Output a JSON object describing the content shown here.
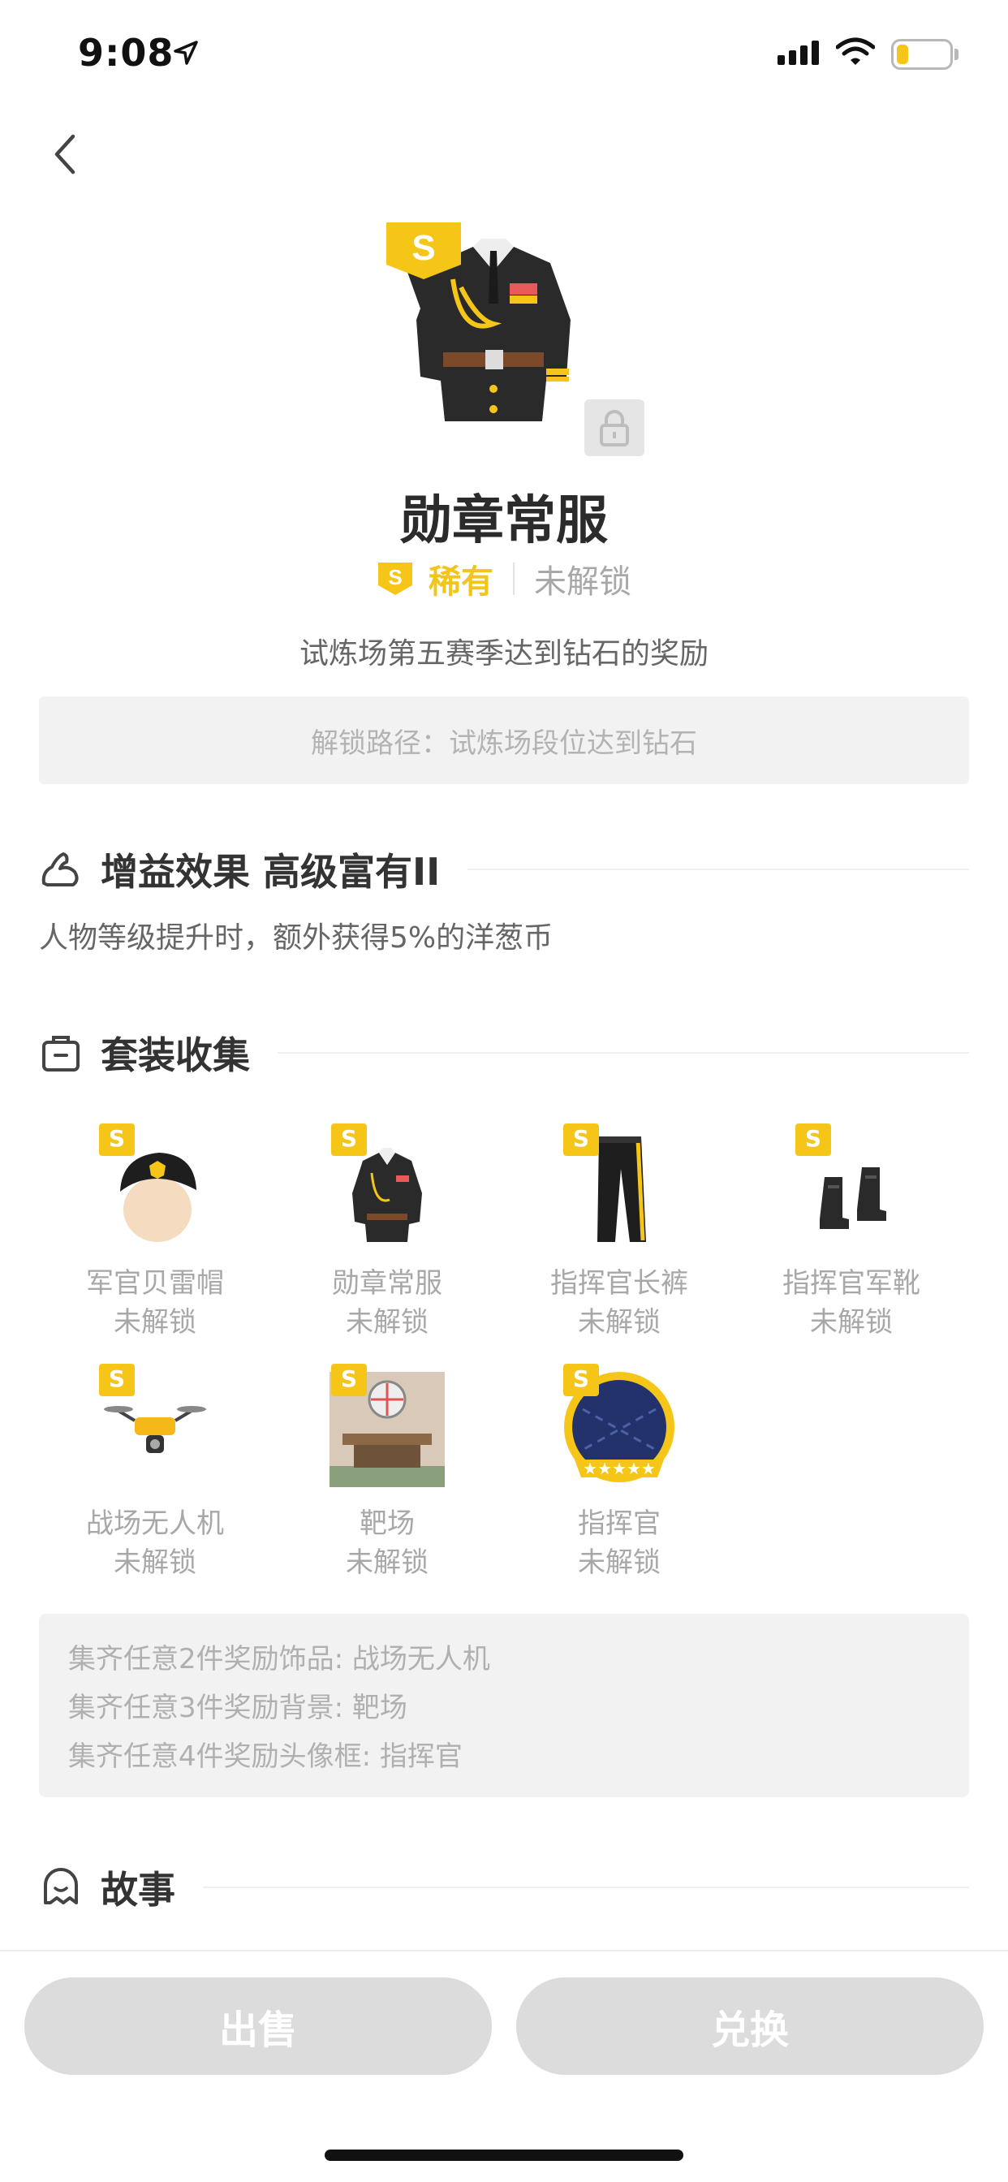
{
  "status_bar": {
    "time": "9:08"
  },
  "item": {
    "title": "勋章常服",
    "rarity_badge": "S",
    "rarity": "稀有",
    "lock_status": "未解锁",
    "description": "试炼场第五赛季达到钻石的奖励",
    "unlock_path": "解锁路径：试炼场段位达到钻石"
  },
  "buff": {
    "title": "增益效果 高级富有II",
    "description": "人物等级提升时，额外获得5%的洋葱币"
  },
  "suit": {
    "title": "套装收集",
    "items": [
      {
        "name": "军官贝雷帽",
        "status": "未解锁",
        "badge": "S",
        "icon": "beret-icon"
      },
      {
        "name": "勋章常服",
        "status": "未解锁",
        "badge": "S",
        "icon": "uniform-icon"
      },
      {
        "name": "指挥官长裤",
        "status": "未解锁",
        "badge": "S",
        "icon": "trousers-icon"
      },
      {
        "name": "指挥官军靴",
        "status": "未解锁",
        "badge": "S",
        "icon": "boots-icon"
      },
      {
        "name": "战场无人机",
        "status": "未解锁",
        "badge": "S",
        "icon": "drone-icon"
      },
      {
        "name": "靶场",
        "status": "未解锁",
        "badge": "S",
        "icon": "shooting-range-icon"
      },
      {
        "name": "指挥官",
        "status": "未解锁",
        "badge": "S",
        "icon": "avatar-frame-icon"
      }
    ],
    "bonuses": [
      "集齐任意2件奖励饰品: 战场无人机",
      "集齐任意3件奖励背景: 靶场",
      "集齐任意4件奖励头像框: 指挥官"
    ]
  },
  "story": {
    "title": "故事"
  },
  "actions": {
    "sell": "出售",
    "exchange": "兑换"
  },
  "colors": {
    "accent": "#f5c518",
    "button_disabled": "#dcdcdc",
    "muted_text": "#a8a8a8"
  }
}
